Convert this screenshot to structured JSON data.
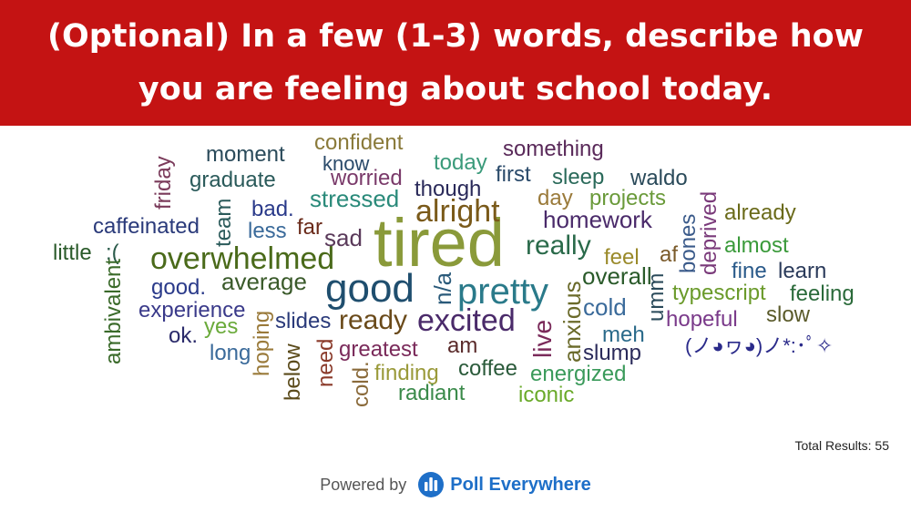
{
  "header": {
    "question": "(Optional) In a few (1-3) words, describe how you are feeling about school today.",
    "background_color": "#c41313"
  },
  "word_cloud": [
    {
      "text": "tired",
      "color": "#8a9a3a",
      "size": 74,
      "vertical": false
    },
    {
      "text": "good",
      "color": "#1f4e6e",
      "size": 44,
      "vertical": false
    },
    {
      "text": "pretty",
      "color": "#2a7a8a",
      "size": 40,
      "vertical": false
    },
    {
      "text": "overwhelmed",
      "color": "#4a6a1a",
      "size": 34,
      "vertical": false
    },
    {
      "text": "excited",
      "color": "#4a2a6a",
      "size": 34,
      "vertical": false
    },
    {
      "text": "alright",
      "color": "#7a5a1a",
      "size": 34,
      "vertical": false
    },
    {
      "text": "ready",
      "color": "#6a4a1a",
      "size": 30,
      "vertical": false
    },
    {
      "text": "really",
      "color": "#2a6a4a",
      "size": 30,
      "vertical": false
    },
    {
      "text": "stressed",
      "color": "#2a8a7a",
      "size": 26,
      "vertical": false
    },
    {
      "text": "homework",
      "color": "#4a2a6a",
      "size": 26,
      "vertical": false
    },
    {
      "text": "average",
      "color": "#3a5a2a",
      "size": 26,
      "vertical": false
    },
    {
      "text": "sad",
      "color": "#5a3a5a",
      "size": 26,
      "vertical": false
    },
    {
      "text": "cold",
      "color": "#3a6a9a",
      "size": 26,
      "vertical": false
    },
    {
      "text": "overall",
      "color": "#2a5a2a",
      "size": 26,
      "vertical": false
    },
    {
      "text": "something",
      "color": "#5a2a5a",
      "size": 24,
      "vertical": false
    },
    {
      "text": "confident",
      "color": "#8a7a3a",
      "size": 24,
      "vertical": false
    },
    {
      "text": "moment",
      "color": "#2a4a5a",
      "size": 24,
      "vertical": false
    },
    {
      "text": "graduate",
      "color": "#2a5a5a",
      "size": 24,
      "vertical": false
    },
    {
      "text": "know",
      "color": "#2a4a6a",
      "size": 22,
      "vertical": false
    },
    {
      "text": "worried",
      "color": "#7a3a6a",
      "size": 24,
      "vertical": false
    },
    {
      "text": "today",
      "color": "#3a9a7a",
      "size": 24,
      "vertical": false
    },
    {
      "text": "first",
      "color": "#2a4a6a",
      "size": 24,
      "vertical": false
    },
    {
      "text": "sleep",
      "color": "#2a6a5a",
      "size": 24,
      "vertical": false
    },
    {
      "text": "waldo",
      "color": "#2a4a5a",
      "size": 24,
      "vertical": false
    },
    {
      "text": "though",
      "color": "#2a2a5a",
      "size": 24,
      "vertical": false
    },
    {
      "text": "day",
      "color": "#9a7a3a",
      "size": 24,
      "vertical": false
    },
    {
      "text": "projects",
      "color": "#6a9a3a",
      "size": 24,
      "vertical": false
    },
    {
      "text": "bad.",
      "color": "#2a3a8a",
      "size": 24,
      "vertical": false
    },
    {
      "text": "far",
      "color": "#6a2a1a",
      "size": 24,
      "vertical": false
    },
    {
      "text": "less",
      "color": "#3a6a9a",
      "size": 24,
      "vertical": false
    },
    {
      "text": "caffeinated",
      "color": "#2a3a7a",
      "size": 24,
      "vertical": false
    },
    {
      "text": "already",
      "color": "#6a6a1a",
      "size": 24,
      "vertical": false
    },
    {
      "text": "almost",
      "color": "#3a9a3a",
      "size": 24,
      "vertical": false
    },
    {
      "text": "feel",
      "color": "#9a8a2a",
      "size": 24,
      "vertical": false
    },
    {
      "text": "af",
      "color": "#7a5a2a",
      "size": 24,
      "vertical": false
    },
    {
      "text": "fine",
      "color": "#2a5a8a",
      "size": 24,
      "vertical": false
    },
    {
      "text": "learn",
      "color": "#2a3a5a",
      "size": 24,
      "vertical": false
    },
    {
      "text": "little",
      "color": "#2a5a2a",
      "size": 24,
      "vertical": false
    },
    {
      "text": ":(",
      "color": "#2a5a4a",
      "size": 24,
      "vertical": false
    },
    {
      "text": "good.",
      "color": "#2a3a8a",
      "size": 24,
      "vertical": false
    },
    {
      "text": "typescript",
      "color": "#6a9a2a",
      "size": 24,
      "vertical": false
    },
    {
      "text": "feeling",
      "color": "#2a6a3a",
      "size": 24,
      "vertical": false
    },
    {
      "text": "experience",
      "color": "#3a3a8a",
      "size": 24,
      "vertical": false
    },
    {
      "text": "slides",
      "color": "#2a3a7a",
      "size": 24,
      "vertical": false
    },
    {
      "text": "hopeful",
      "color": "#7a3a8a",
      "size": 24,
      "vertical": false
    },
    {
      "text": "slow",
      "color": "#5a5a2a",
      "size": 24,
      "vertical": false
    },
    {
      "text": "yes",
      "color": "#6aaa3a",
      "size": 24,
      "vertical": false
    },
    {
      "text": "ok.",
      "color": "#2a2a6a",
      "size": 24,
      "vertical": false
    },
    {
      "text": "meh",
      "color": "#2a6a8a",
      "size": 24,
      "vertical": false
    },
    {
      "text": "am",
      "color": "#5a2a2a",
      "size": 24,
      "vertical": false
    },
    {
      "text": "long",
      "color": "#3a6a9a",
      "size": 24,
      "vertical": false
    },
    {
      "text": "greatest",
      "color": "#7a2a5a",
      "size": 24,
      "vertical": false
    },
    {
      "text": "slump",
      "color": "#2a2a5a",
      "size": 24,
      "vertical": false
    },
    {
      "text": "(ノ◕ヮ◕)ノ*:･ﾟ✧",
      "color": "#2a2a8a",
      "size": 22,
      "vertical": false
    },
    {
      "text": "coffee",
      "color": "#2a5a3a",
      "size": 24,
      "vertical": false
    },
    {
      "text": "finding",
      "color": "#9a9a3a",
      "size": 24,
      "vertical": false
    },
    {
      "text": "energized",
      "color": "#3a9a5a",
      "size": 24,
      "vertical": false
    },
    {
      "text": "radiant",
      "color": "#3a8a4a",
      "size": 24,
      "vertical": false
    },
    {
      "text": "iconic",
      "color": "#6aaa2a",
      "size": 24,
      "vertical": false
    },
    {
      "text": "friday",
      "color": "#7a3a5a",
      "size": 24,
      "vertical": true
    },
    {
      "text": "team",
      "color": "#2a5a5a",
      "size": 24,
      "vertical": true
    },
    {
      "text": "ambivalent",
      "color": "#3a6a2a",
      "size": 24,
      "vertical": true
    },
    {
      "text": "hoping",
      "color": "#9a7a3a",
      "size": 24,
      "vertical": true
    },
    {
      "text": "below",
      "color": "#5a4a1a",
      "size": 24,
      "vertical": true
    },
    {
      "text": "need",
      "color": "#8a3a2a",
      "size": 24,
      "vertical": true
    },
    {
      "text": "cold.",
      "color": "#8a6a3a",
      "size": 24,
      "vertical": true
    },
    {
      "text": "n/a",
      "color": "#2a5a7a",
      "size": 26,
      "vertical": true
    },
    {
      "text": "live",
      "color": "#7a2a5a",
      "size": 28,
      "vertical": true
    },
    {
      "text": "anxious",
      "color": "#6a6a2a",
      "size": 26,
      "vertical": true
    },
    {
      "text": "umm",
      "color": "#2a4a5a",
      "size": 24,
      "vertical": true
    },
    {
      "text": "bones",
      "color": "#3a5a8a",
      "size": 24,
      "vertical": true
    },
    {
      "text": "deprived",
      "color": "#7a3a7a",
      "size": 24,
      "vertical": true
    }
  ],
  "total_results": "Total Results: 55",
  "footer": {
    "powered_by": "Powered by",
    "brand": "Poll Everywhere",
    "brand_color": "#1e6fc8"
  }
}
